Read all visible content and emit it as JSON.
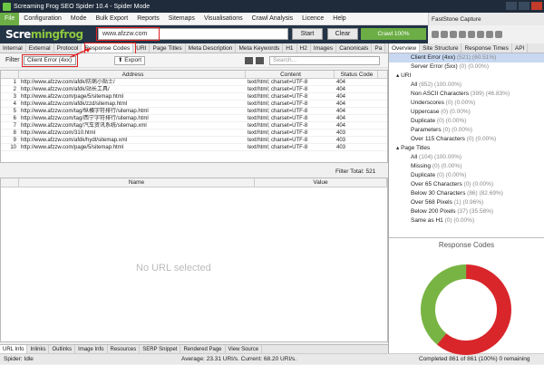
{
  "window": {
    "title": "Screaming Frog SEO Spider 10.4 - Spider Mode"
  },
  "capture_tool": {
    "title": "FastStone Capture"
  },
  "menu": [
    "File",
    "Configuration",
    "Mode",
    "Bulk Export",
    "Reports",
    "Sitemaps",
    "Visualisations",
    "Crawl Analysis",
    "Licence",
    "Help"
  ],
  "toolbar": {
    "logo_a": "Scre",
    "logo_b": "mingfrog",
    "url": "www.afzzw.com",
    "start": "Start",
    "clear": "Clear",
    "crawl_progress": "Crawl 100%"
  },
  "main_tabs": [
    "Internal",
    "External",
    "Protocol",
    "Response Codes",
    "URI",
    "Page Titles",
    "Meta Description",
    "Meta Keywords",
    "H1",
    "H2",
    "Images",
    "Canonicals",
    "Pa"
  ],
  "filter": {
    "label": "Filter",
    "value": "Client Error (4xx)",
    "export": "Export",
    "search_placeholder": "Search..."
  },
  "table": {
    "headers": [
      "",
      "Address",
      "Content",
      "Status Code"
    ],
    "rows": [
      [
        "1",
        "http://www.afzzw.com/afdk/防病小贴士/",
        "text/html; charset=UTF-8",
        "404"
      ],
      [
        "2",
        "http://www.afzzw.com/afdk/站长工具/",
        "text/html; charset=UTF-8",
        "404"
      ],
      [
        "3",
        "http://www.afzzw.com/page/5/sitemap.html",
        "text/html; charset=UTF-8",
        "404"
      ],
      [
        "4",
        "http://www.afzzw.com/afdk/zzd/sitemap.html",
        "text/html; charset=UTF-8",
        "404"
      ],
      [
        "5",
        "http://www.afzzw.com/tag/纵横字符排行/sitemap.html",
        "text/html; charset=UTF-8",
        "404"
      ],
      [
        "6",
        "http://www.afzzw.com/tag/西宁字符排行/sitemap.html",
        "text/html; charset=UTF-8",
        "404"
      ],
      [
        "7",
        "http://www.afzzw.com/tag/汽车资讯系统/sitemap.xml",
        "text/html; charset=UTF-8",
        "404"
      ],
      [
        "8",
        "http://www.afzzw.com/310.html",
        "text/html; charset=UTF-8",
        "403"
      ],
      [
        "9",
        "http://www.afzzw.com/afdk/hydt/sitemap.xml",
        "text/html; charset=UTF-8",
        "403"
      ],
      [
        "10",
        "http://www.afzzw.com/page/5/sitemap.html",
        "text/html; charset=UTF-8",
        "403"
      ]
    ],
    "filter_total_label": "Filter Total:",
    "filter_total": "521"
  },
  "lower_panel": {
    "headers": [
      "Name",
      "Value"
    ],
    "empty_text": "No URL selected"
  },
  "bottom_tabs": [
    "URL Info",
    "Inlinks",
    "Outlinks",
    "Image Info",
    "Resources",
    "SERP Snippet",
    "Rendered Page",
    "View Source"
  ],
  "status": {
    "left": "Spider: Idle",
    "middle": "Average: 23.31 URI/s. Current: 68.20 URI/s.",
    "right": "Completed 861 of 861 (100%) 0 remaining"
  },
  "right_tabs": [
    "Overview",
    "Site Structure",
    "Response Times",
    "API"
  ],
  "overview": [
    {
      "text": "Client Error (4xx)",
      "count": "(521) (60.51%)",
      "indent": 3,
      "sel": true
    },
    {
      "text": "Server Error (5xx)",
      "count": "(0) (0.00%)",
      "indent": 3
    },
    {
      "text": "▴ URI",
      "count": "",
      "indent": 1
    },
    {
      "text": "All",
      "count": "(852) (100.00%)",
      "indent": 3
    },
    {
      "text": "Non ASCII Characters",
      "count": "(399) (46.83%)",
      "indent": 3
    },
    {
      "text": "Underscores",
      "count": "(0) (0.00%)",
      "indent": 3
    },
    {
      "text": "Uppercase",
      "count": "(0) (0.00%)",
      "indent": 3
    },
    {
      "text": "Duplicate",
      "count": "(0) (0.00%)",
      "indent": 3
    },
    {
      "text": "Parameters",
      "count": "(0) (0.00%)",
      "indent": 3
    },
    {
      "text": "Over 115 Characters",
      "count": "(0) (0.00%)",
      "indent": 3
    },
    {
      "text": "▴ Page Titles",
      "count": "",
      "indent": 1
    },
    {
      "text": "All",
      "count": "(104) (100.00%)",
      "indent": 3
    },
    {
      "text": "Missing",
      "count": "(0) (0.00%)",
      "indent": 3
    },
    {
      "text": "Duplicate",
      "count": "(0) (0.00%)",
      "indent": 3
    },
    {
      "text": "Over 65 Characters",
      "count": "(0) (0.00%)",
      "indent": 3
    },
    {
      "text": "Below 30 Characters",
      "count": "(86) (82.69%)",
      "indent": 3
    },
    {
      "text": "Over 568 Pixels",
      "count": "(1) (0.96%)",
      "indent": 3
    },
    {
      "text": "Below 200 Pixels",
      "count": "(37) (35.58%)",
      "indent": 3
    },
    {
      "text": "Same as H1",
      "count": "(0) (0.00%)",
      "indent": 3
    }
  ],
  "response_codes": {
    "title": "Response Codes",
    "share": {
      "client_error": 0.61,
      "other": 0.39
    },
    "colors": {
      "client_error": "#d9262b",
      "other": "#78b443"
    }
  },
  "colors": {
    "accent": "#6cae45",
    "highlight": "#e02020"
  }
}
